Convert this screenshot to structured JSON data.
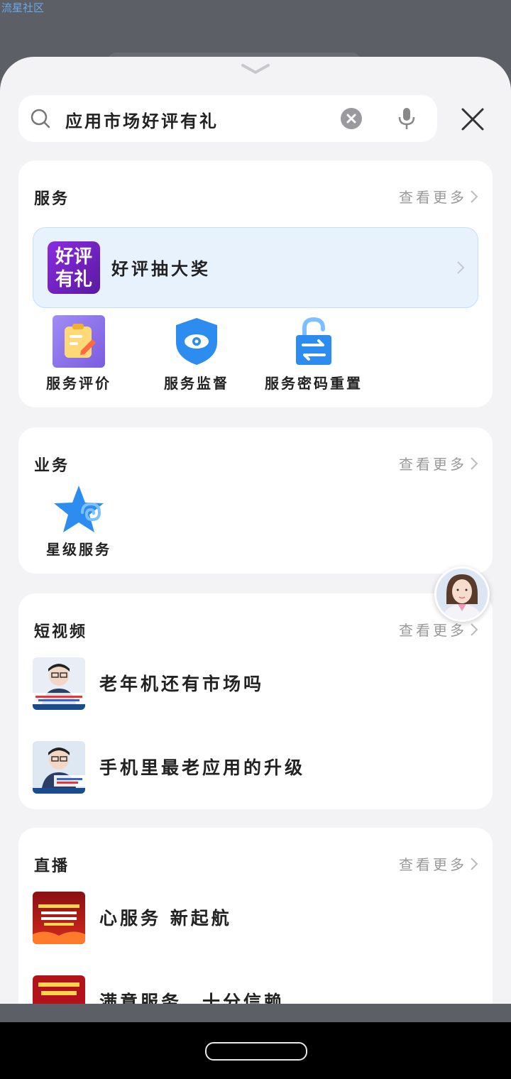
{
  "watermark": "流星社区",
  "search": {
    "value": "应用市场好评有礼"
  },
  "services": {
    "title": "服务",
    "more": "查看更多",
    "banner": {
      "logo_line1": "好评",
      "logo_line2": "有礼",
      "title": "好评抽大奖"
    },
    "items": [
      {
        "label": "服务评价",
        "icon": "review-icon"
      },
      {
        "label": "服务监督",
        "icon": "eye-shield-icon"
      },
      {
        "label": "服务密码重置",
        "icon": "unlock-icon"
      }
    ]
  },
  "business": {
    "title": "业务",
    "more": "查看更多",
    "items": [
      {
        "label": "星级服务",
        "icon": "star-icon"
      }
    ]
  },
  "videos": {
    "title": "短视频",
    "more": "查看更多",
    "items": [
      {
        "title": "老年机还有市场吗"
      },
      {
        "title": "手机里最老应用的升级"
      }
    ]
  },
  "live": {
    "title": "直播",
    "more": "查看更多",
    "items": [
      {
        "title": "心服务 新起航"
      },
      {
        "title": "满意服务，十分信赖"
      }
    ]
  },
  "colors": {
    "accent": "#2d8cf0",
    "brand_purple": "#7b22d8"
  }
}
